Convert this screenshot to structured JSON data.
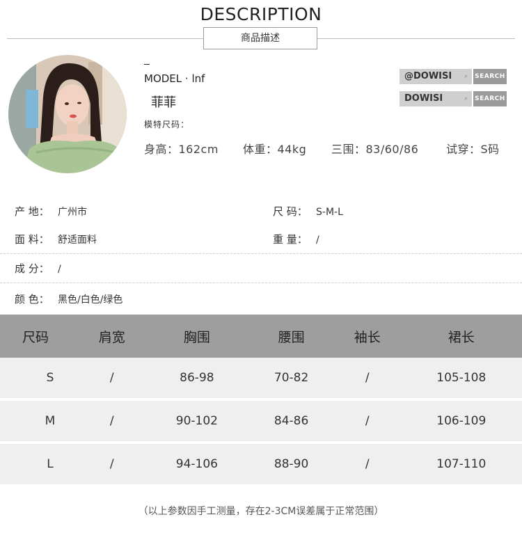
{
  "header": {
    "title": "DESCRIPTION",
    "subtitle": "商品描述"
  },
  "model": {
    "dash": "_",
    "name": "MODEL · lnf",
    "cn_name": "菲菲",
    "size_label": "模特尺码：",
    "stats": [
      "身高：162cm",
      "体重：44kg",
      "三围：83/60/86",
      "试穿：S码"
    ]
  },
  "search": [
    {
      "text": "@DOWISI",
      "button": "SEARCH"
    },
    {
      "text": "DOWISI",
      "button": "SEARCH"
    }
  ],
  "attributes": {
    "origin": {
      "label": "产    地：",
      "value": "广州市"
    },
    "size": {
      "label": "尺    码：",
      "value": "S-M-L"
    },
    "fabric": {
      "label": "面    料：",
      "value": "舒适面料"
    },
    "weight": {
      "label": "重    量：",
      "value": "/"
    },
    "composition": {
      "label": "成    分：",
      "value": "/"
    },
    "color": {
      "label": "颜    色：",
      "value": "黑色/白色/绿色"
    }
  },
  "size_table": {
    "headers": [
      "尺码",
      "肩宽",
      "胸围",
      "腰围",
      "袖长",
      "裙长"
    ],
    "rows": [
      [
        "S",
        "/",
        "86-98",
        "70-82",
        "/",
        "105-108"
      ],
      [
        "M",
        "/",
        "90-102",
        "84-86",
        "/",
        "106-109"
      ],
      [
        "L",
        "/",
        "94-106",
        "88-90",
        "/",
        "107-110"
      ]
    ]
  },
  "note": "（以上参数因手工测量，存在2-3CM误差属于正常范围）",
  "colors": {
    "header_bg": "#9e9e9e",
    "row_bg": "#efefef",
    "search_field": "#cfcfcf",
    "search_button": "#9b9b9b"
  }
}
